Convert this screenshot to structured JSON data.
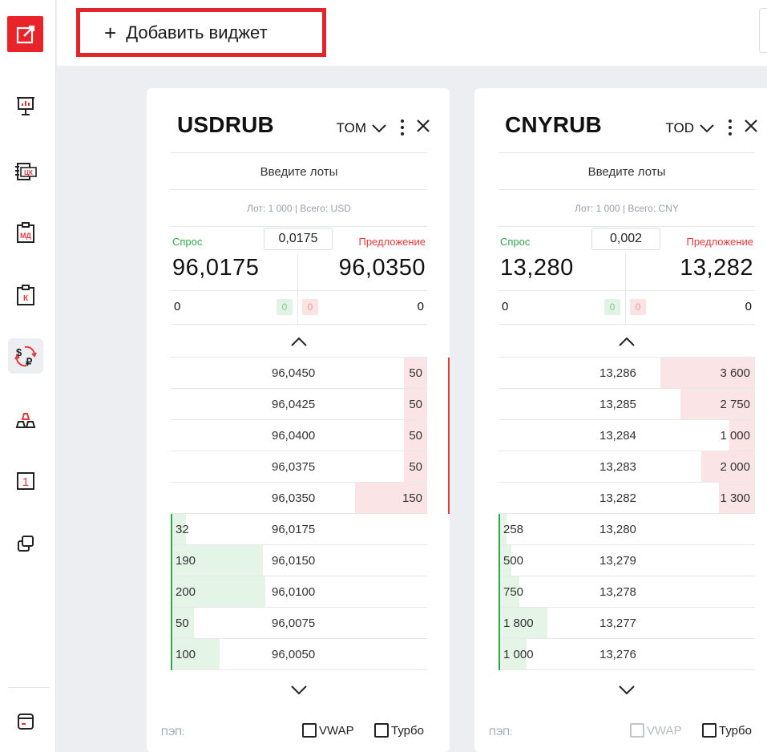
{
  "toolbar": {
    "add_widget_label": "Добавить виджет"
  },
  "sidebar": {
    "items": [
      {
        "icon": "presentation-chart-icon"
      },
      {
        "icon": "document-ck-icon",
        "badge": "ЦК"
      },
      {
        "icon": "clipboard-md-icon",
        "badge": "МД"
      },
      {
        "icon": "clipboard-k-icon",
        "badge": "К"
      },
      {
        "icon": "currency-exchange-icon",
        "active": true
      },
      {
        "icon": "ingots-icon"
      },
      {
        "icon": "number-one-icon",
        "badge": "1"
      },
      {
        "icon": "windows-icon"
      }
    ],
    "bottom_icon": "terminal-icon"
  },
  "colors": {
    "accent": "#e8242a",
    "bid": "#2fa54b",
    "ask": "#e5383b"
  },
  "widgets": [
    {
      "ticker": "USDRUB",
      "term": "TOM",
      "lots_placeholder": "Введите лоты",
      "lot_info": "Лот: 1 000 | Всего: USD",
      "bid_label": "Спрос",
      "ask_label": "Предложение",
      "spread": "0,0175",
      "bid_price": "96,0175",
      "ask_price": "96,0350",
      "bid_qty": "0",
      "ask_qty": "0",
      "pill_bid": "0",
      "pill_ask": "0",
      "asks": [
        {
          "price": "96,0450",
          "volume": "50",
          "fill": 0.09
        },
        {
          "price": "96,0425",
          "volume": "50",
          "fill": 0.09
        },
        {
          "price": "96,0400",
          "volume": "50",
          "fill": 0.09
        },
        {
          "price": "96,0375",
          "volume": "50",
          "fill": 0.09
        },
        {
          "price": "96,0350",
          "volume": "150",
          "fill": 0.28
        }
      ],
      "bids": [
        {
          "price": "96,0175",
          "volume": "32",
          "fill": 0.06
        },
        {
          "price": "96,0150",
          "volume": "190",
          "fill": 0.36
        },
        {
          "price": "96,0100",
          "volume": "200",
          "fill": 0.37
        },
        {
          "price": "96,0075",
          "volume": "50",
          "fill": 0.09
        },
        {
          "price": "96,0050",
          "volume": "100",
          "fill": 0.19
        }
      ],
      "footer_label": "ПЭП:",
      "vwap_label": "VWAP",
      "vwap_disabled": false,
      "turbo_label": "Турбо"
    },
    {
      "ticker": "CNYRUB",
      "term": "TOD",
      "lots_placeholder": "Введите лоты",
      "lot_info": "Лот: 1 000 | Всего: CNY",
      "bid_label": "Спрос",
      "ask_label": "Предложение",
      "spread": "0,002",
      "bid_price": "13,280",
      "ask_price": "13,282",
      "bid_qty": "0",
      "ask_qty": "0",
      "pill_bid": "0",
      "pill_ask": "0",
      "asks": [
        {
          "price": "13,286",
          "volume": "3 600",
          "fill": 0.37
        },
        {
          "price": "13,285",
          "volume": "2 750",
          "fill": 0.29
        },
        {
          "price": "13,284",
          "volume": "1 000",
          "fill": 0.1
        },
        {
          "price": "13,283",
          "volume": "2 000",
          "fill": 0.21
        },
        {
          "price": "13,282",
          "volume": "1 300",
          "fill": 0.14
        }
      ],
      "bids": [
        {
          "price": "13,280",
          "volume": "258",
          "fill": 0.03
        },
        {
          "price": "13,279",
          "volume": "500",
          "fill": 0.05
        },
        {
          "price": "13,278",
          "volume": "750",
          "fill": 0.08
        },
        {
          "price": "13,277",
          "volume": "1 800",
          "fill": 0.19
        },
        {
          "price": "13,276",
          "volume": "1 000",
          "fill": 0.11
        }
      ],
      "footer_label": "ПЭП:",
      "vwap_label": "VWAP",
      "vwap_disabled": true,
      "turbo_label": "Турбо"
    }
  ]
}
